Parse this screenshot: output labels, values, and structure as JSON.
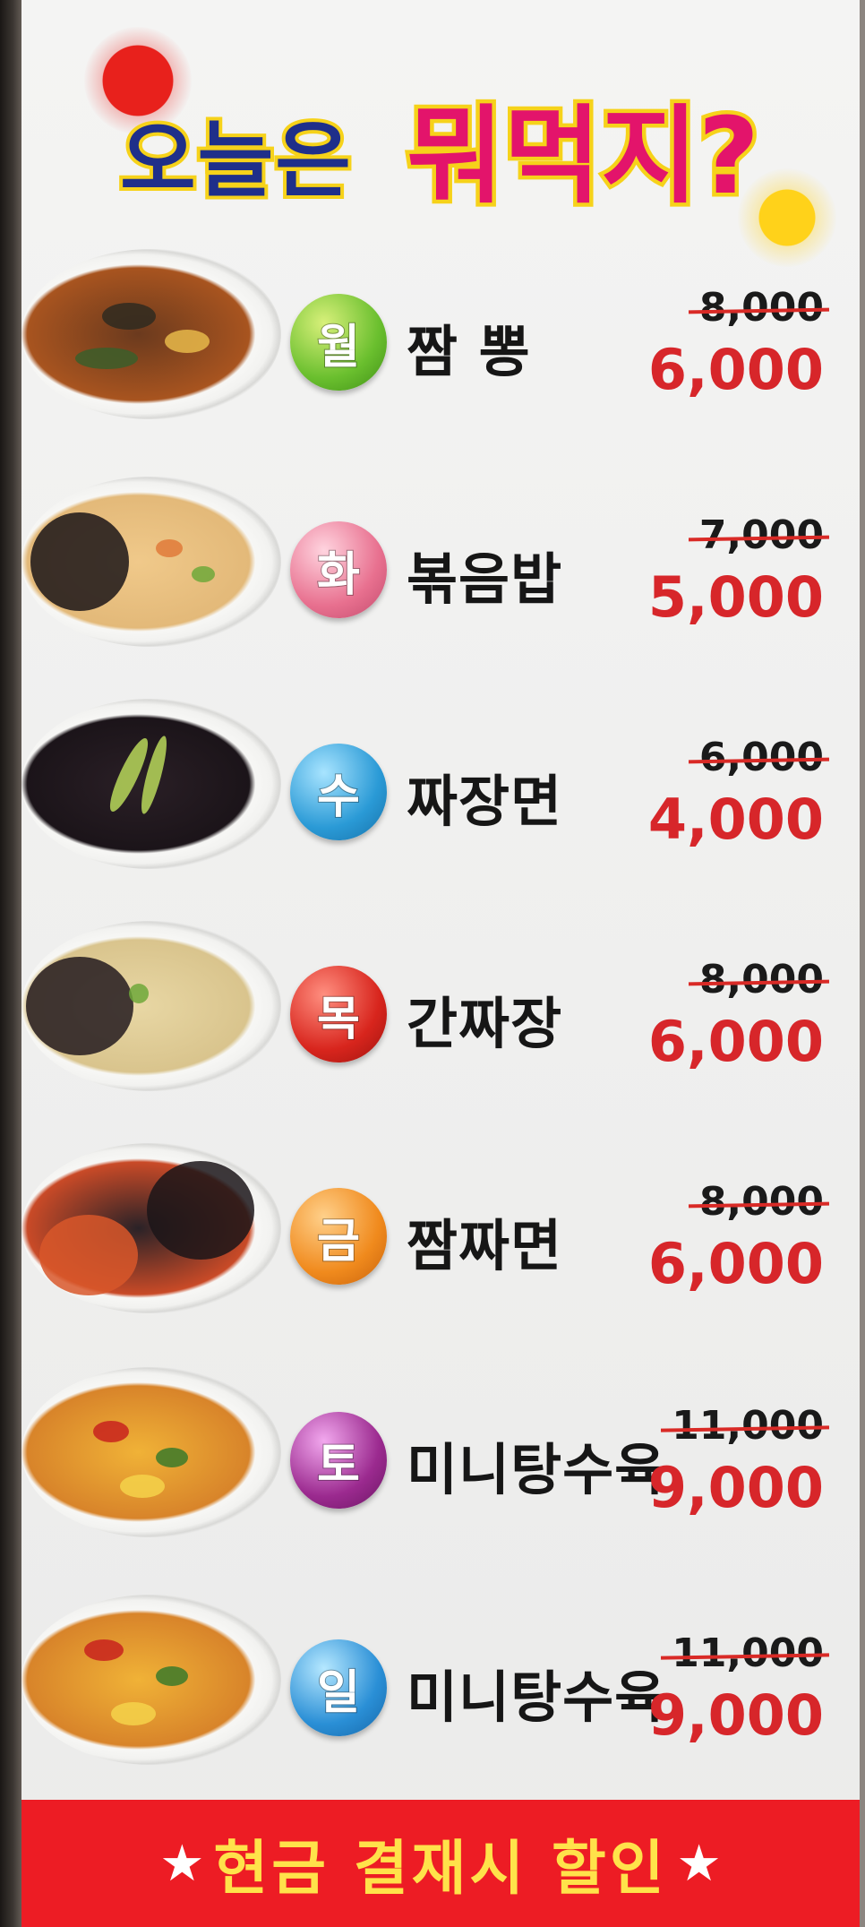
{
  "header": {
    "title_part1": "오늘은",
    "title_part2": "뭐먹지?"
  },
  "menu": [
    {
      "day": "월",
      "dish": "짬  뽕",
      "old_price": "8,000",
      "new_price": "6,000",
      "badge_color": "#6abf2e"
    },
    {
      "day": "화",
      "dish": "볶음밥",
      "old_price": "7,000",
      "new_price": "5,000",
      "badge_color": "#e8708f"
    },
    {
      "day": "수",
      "dish": "짜장면",
      "old_price": "6,000",
      "new_price": "4,000",
      "badge_color": "#2a9ad6"
    },
    {
      "day": "목",
      "dish": "간짜장",
      "old_price": "8,000",
      "new_price": "6,000",
      "badge_color": "#d8251d"
    },
    {
      "day": "금",
      "dish": "짬짜면",
      "old_price": "8,000",
      "new_price": "6,000",
      "badge_color": "#f08a1d"
    },
    {
      "day": "토",
      "dish": "미니탕수육",
      "old_price": "11,000",
      "new_price": "9,000",
      "badge_color": "#9b2a8f"
    },
    {
      "day": "일",
      "dish": "미니탕수육",
      "old_price": "11,000",
      "new_price": "9,000",
      "badge_color": "#2a8fd6"
    }
  ],
  "footer": {
    "star_left": "★",
    "text": "현금 결재시 할인",
    "star_right": "★"
  }
}
